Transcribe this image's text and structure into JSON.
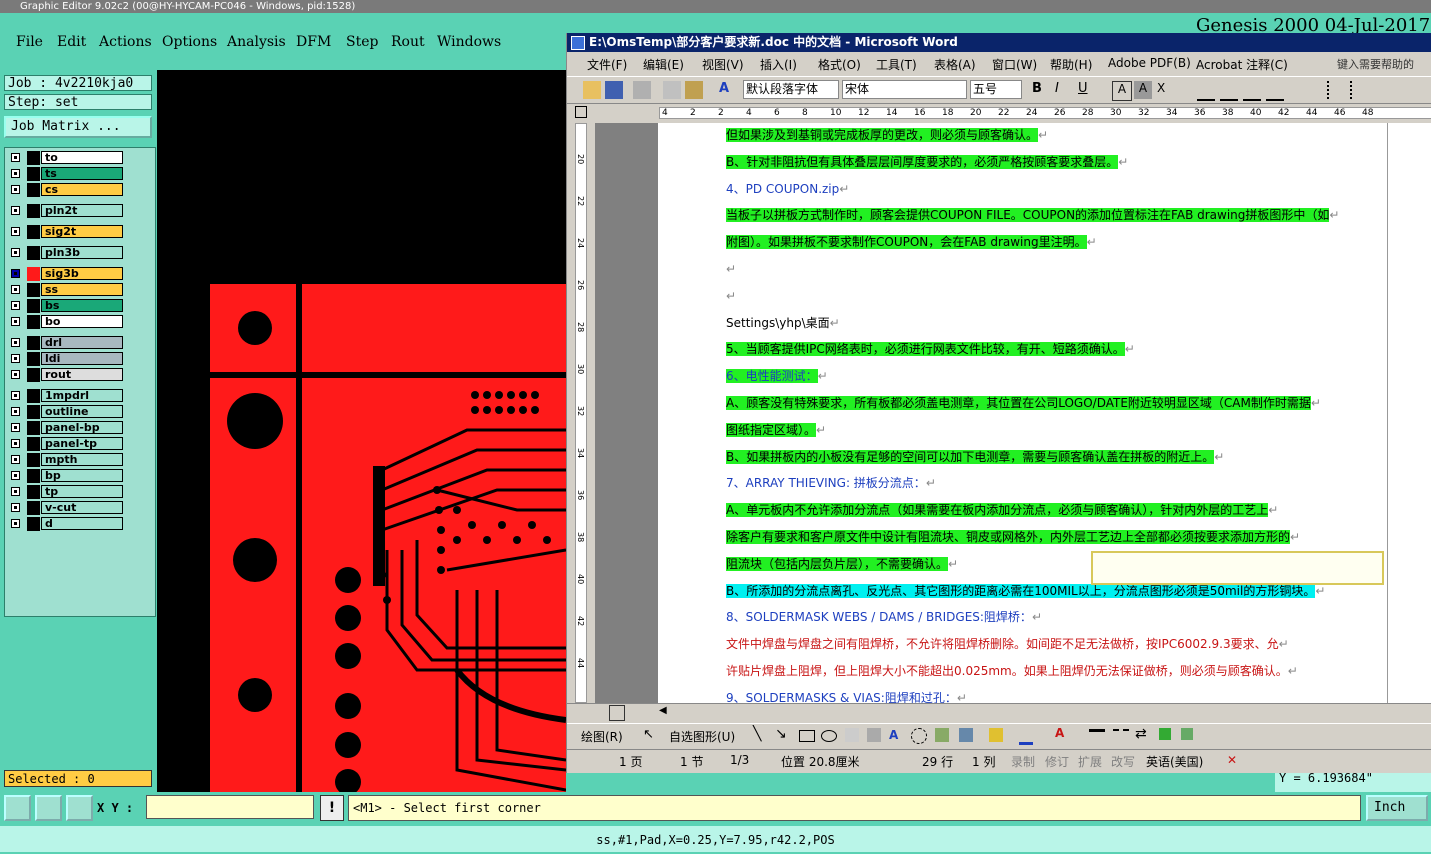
{
  "ge": {
    "title": "Graphic Editor 9.02c2 (00@HY-HYCAM-PC046 - Windows, pid:1528)",
    "menu": [
      "File",
      "Edit",
      "Actions",
      "Options",
      "Analysis",
      "DFM",
      "Step",
      "Rout",
      "Windows"
    ],
    "job_label": "Job : 4v2210kja0",
    "step_label": "Step: set",
    "job_matrix_btn": "Job Matrix ...",
    "layers": [
      {
        "name": "to",
        "color": "#ffffff"
      },
      {
        "name": "ts",
        "color": "#1aa878"
      },
      {
        "name": "cs",
        "color": "#ffcc44"
      },
      {
        "name": "pln2t",
        "color": "#9fe0d0"
      },
      {
        "name": "sig2t",
        "color": "#ffcc44"
      },
      {
        "name": "pln3b",
        "color": "#9fe0d0"
      },
      {
        "name": "sig3b",
        "color": "#ffcc44",
        "active": true
      },
      {
        "name": "ss",
        "color": "#ffcc44"
      },
      {
        "name": "bs",
        "color": "#1aa878"
      },
      {
        "name": "bo",
        "color": "#ffffff"
      },
      {
        "name": "drl",
        "color": "#a8b8c0"
      },
      {
        "name": "ldi",
        "color": "#a8b8c0"
      },
      {
        "name": "rout",
        "color": "#dddddd"
      },
      {
        "name": "1mpdrl",
        "color": "#9fe0d0"
      },
      {
        "name": "outline",
        "color": "#9fe0d0"
      },
      {
        "name": "panel-bp",
        "color": "#9fe0d0"
      },
      {
        "name": "panel-tp",
        "color": "#9fe0d0"
      },
      {
        "name": "mpth",
        "color": "#9fe0d0"
      },
      {
        "name": "bp",
        "color": "#9fe0d0"
      },
      {
        "name": "tp",
        "color": "#9fe0d0"
      },
      {
        "name": "v-cut",
        "color": "#9fe0d0"
      },
      {
        "name": "d",
        "color": "#9fe0d0"
      }
    ],
    "selected_label": "Selected : 0",
    "xy_label": "X Y :",
    "excl": "!",
    "prompt": "<M1> - Select first corner",
    "units": "Inch",
    "status": "ss,#1,Pad,X=0.25,Y=7.95,r42.2,POS",
    "y_readout": "Y = 6.193684\"",
    "genesis": "Genesis 2000 04-Jul-2017",
    "canvas_color": "#ff1a1a"
  },
  "word": {
    "title": "E:\\OmsTemp\\部分客户要求新.doc 中的文档 - Microsoft Word",
    "menu": [
      "文件(F)",
      "编辑(E)",
      "视图(V)",
      "插入(I)",
      "格式(O)",
      "工具(T)",
      "表格(A)",
      "窗口(W)",
      "帮助(H)",
      "Adobe PDF(B)",
      "Acrobat 注释(C)"
    ],
    "help_placeholder": "键入需要帮助的",
    "style": "默认段落字体",
    "font": "宋体",
    "size": "五号",
    "ruler_ticks": [
      "4",
      "2",
      "2",
      "4",
      "6",
      "8",
      "10",
      "12",
      "14",
      "16",
      "18",
      "20",
      "22",
      "24",
      "26",
      "28",
      "30",
      "32",
      "34",
      "36",
      "38",
      "40",
      "42",
      "44",
      "46",
      "48"
    ],
    "vruler_ticks": [
      "20",
      "22",
      "24",
      "26",
      "28",
      "30",
      "32",
      "34",
      "36",
      "38",
      "40",
      "42",
      "44"
    ],
    "lines": [
      {
        "t": "但如果涉及到基铜或完成板厚的更改，则必须与顾客确认。",
        "hl": "g",
        "c": ""
      },
      {
        "t": "B、针对非阻抗但有具体叠层层间厚度要求的，必须严格按顾客要求叠层。",
        "hl": "g",
        "c": ""
      },
      {
        "t": "4、PD COUPON.zip",
        "hl": "",
        "c": "blue"
      },
      {
        "t": "当板子以拼板方式制作时，顾客会提供COUPON FILE。COUPON的添加位置标注在FAB drawing拼板图形中（如",
        "hl": "g",
        "c": ""
      },
      {
        "t": "附图）。如果拼板不要求制作COUPON，会在FAB drawing里注明。",
        "hl": "g",
        "c": ""
      },
      {
        "t": "",
        "hl": "",
        "c": ""
      },
      {
        "t": "",
        "hl": "",
        "c": ""
      },
      {
        "t": "Settings\\yhp\\桌面",
        "hl": "",
        "c": ""
      },
      {
        "t": "5、当顾客提供IPC网络表时，必须进行网表文件比较，有开、短路须确认。",
        "hl": "g",
        "c": ""
      },
      {
        "t": "6、电性能测试：",
        "hl": "g",
        "c": "blue"
      },
      {
        "t": "A、顾客没有特殊要求，所有板都必须盖电测章，其位置在公司LOGO/DATE附近较明显区域（CAM制作时需据",
        "hl": "g",
        "c": ""
      },
      {
        "t": "图纸指定区域）。",
        "hl": "g",
        "c": ""
      },
      {
        "t": "B、如果拼板内的小板没有足够的空间可以加下电测章，需要与顾客确认盖在拼板的附近上。",
        "hl": "g",
        "c": ""
      },
      {
        "t": "7、ARRAY THIEVING: 拼板分流点：",
        "hl": "",
        "c": "blue"
      },
      {
        "t": "A、单元板内不允许添加分流点（如果需要在板内添加分流点，必须与顾客确认），针对内外层的工艺上",
        "hl": "g",
        "c": ""
      },
      {
        "t": "除客户有要求和客户原文件中设计有阻流块、铜皮或网格外，内外层工艺边上全部都必须按要求添加方形的",
        "hl": "g",
        "c": ""
      },
      {
        "t": "阻流块（包括内层负片层），不需要确认。",
        "hl": "g",
        "c": ""
      },
      {
        "t": "B、所添加的分流点离孔、反光点、其它图形的距离必需在100MIL以上，分流点图形必须是50mil的方形铜块。",
        "hl": "c",
        "c": ""
      },
      {
        "t": "8、SOLDERMASK WEBS / DAMS / BRIDGES:阻焊桥：",
        "hl": "",
        "c": "blue"
      },
      {
        "t": "   文件中焊盘与焊盘之间有阻焊桥，不允许将阻焊桥删除。如间距不足无法做桥，按IPC6002.9.3要求、允",
        "hl": "",
        "c": "mixed1"
      },
      {
        "t": "许贴片焊盘上阻焊，但上阻焊大小不能超出0.025mm。如果上阻焊仍无法保证做桥，则必须与顾客确认。",
        "hl": "",
        "c": "mixed2"
      },
      {
        "t": "9、SOLDERMASKS & VIAS:阻焊和过孔：",
        "hl": "",
        "c": "blue"
      }
    ],
    "draw_label": "绘图(R)",
    "autoshape_label": "自选图形(U)",
    "status": {
      "page": "1 页",
      "section": "1 节",
      "pages": "1/3",
      "position": "位置 20.8厘米",
      "line": "29 行",
      "col": "1 列",
      "rec": "录制",
      "trk": "修订",
      "ext": "扩展",
      "ovr": "改写",
      "lang": "英语(美国)"
    }
  }
}
